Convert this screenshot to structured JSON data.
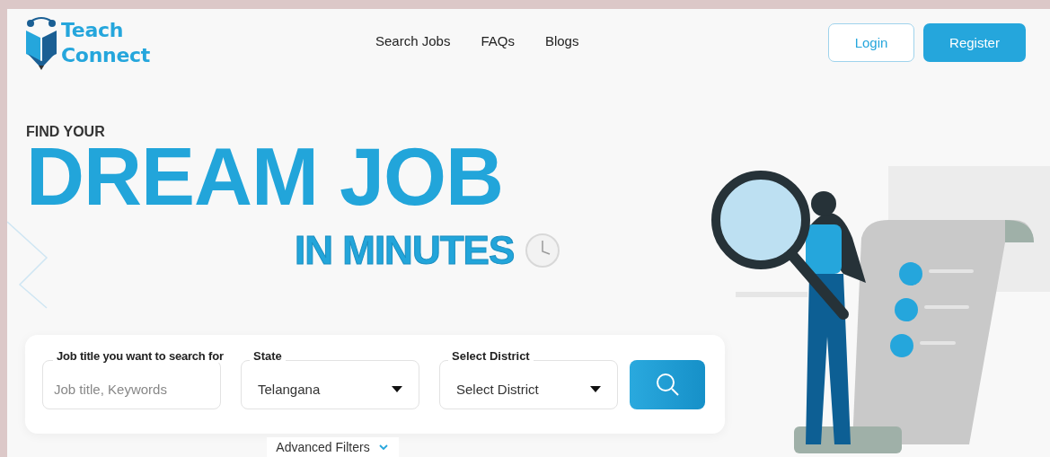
{
  "brand": {
    "line_1": "Teach",
    "line_2": "Connect"
  },
  "nav": [
    {
      "label": "Search Jobs"
    },
    {
      "label": "FAQs"
    },
    {
      "label": "Blogs"
    }
  ],
  "auth_buttons": [
    {
      "label": "Login",
      "kind": "outline"
    },
    {
      "label": "Register",
      "kind": "filled"
    }
  ],
  "hero": {
    "kicker": "FIND YOUR",
    "headline": "DREAM JOB",
    "subline": "IN MINUTES"
  },
  "search": {
    "fields": [
      {
        "kind": "text",
        "label": "Job title you want to search for",
        "placeholder": "Job title, Keywords"
      },
      {
        "kind": "select",
        "label": "State",
        "value": "Telangana"
      },
      {
        "kind": "select",
        "label": "Select District",
        "value": "Select District"
      }
    ],
    "advanced_filters": "Advanced Filters"
  }
}
